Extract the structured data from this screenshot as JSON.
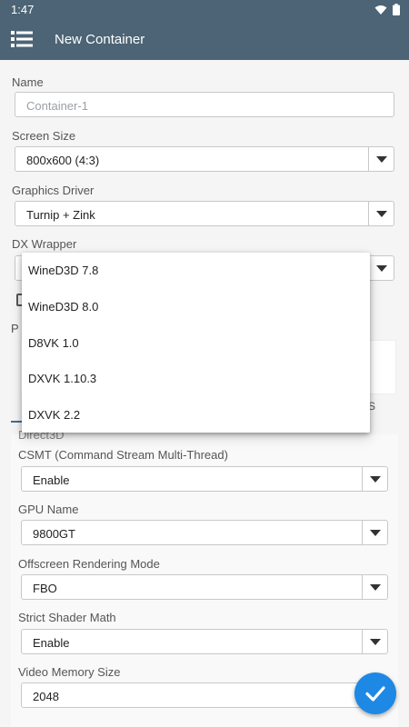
{
  "status": {
    "time": "1:47"
  },
  "appbar": {
    "title": "New Container"
  },
  "form": {
    "name_label": "Name",
    "name_placeholder": "Container-1",
    "screen_size_label": "Screen Size",
    "screen_size_value": "800x600 (4:3)",
    "graphics_driver_label": "Graphics Driver",
    "graphics_driver_value": "Turnip + Zink",
    "dx_wrapper_label": "DX Wrapper"
  },
  "tabs": {
    "visible_partial": "ES"
  },
  "direct3d": {
    "section_title": "Direct3D",
    "csmt_label": "CSMT (Command Stream Multi-Thread)",
    "csmt_value": "Enable",
    "gpu_name_label": "GPU Name",
    "gpu_name_value": "9800GT",
    "offscreen_label": "Offscreen Rendering Mode",
    "offscreen_value": "FBO",
    "strict_shader_label": "Strict Shader Math",
    "strict_shader_value": "Enable",
    "video_memory_label": "Video Memory Size",
    "video_memory_value": "2048"
  },
  "dx_wrapper_options": [
    "WineD3D 7.8",
    "WineD3D 8.0",
    "D8VK 1.0",
    "DXVK 1.10.3",
    "DXVK 2.2"
  ]
}
